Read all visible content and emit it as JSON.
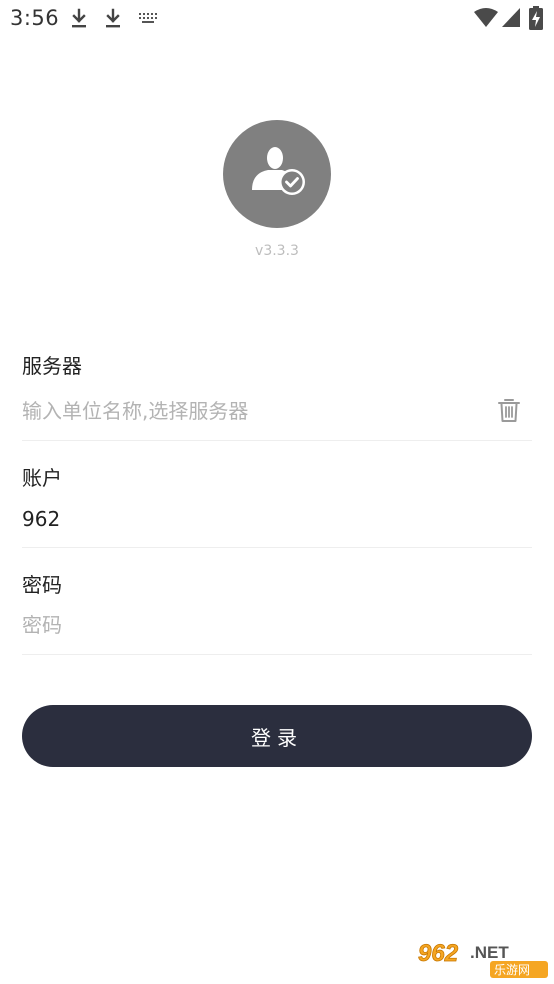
{
  "status_bar": {
    "time": "3:56",
    "icons": [
      "download-icon",
      "download-icon",
      "keyboard-icon",
      "wifi-icon",
      "signal-icon",
      "battery-charging-icon"
    ]
  },
  "header": {
    "avatar_icon": "user-check-icon",
    "version": "v3.3.3"
  },
  "form": {
    "server": {
      "label": "服务器",
      "value": "",
      "placeholder": "输入单位名称,选择服务器",
      "clear_icon": "trash-icon"
    },
    "account": {
      "label": "账户",
      "value": "962",
      "placeholder": ""
    },
    "password": {
      "label": "密码",
      "value": "",
      "placeholder": "密码"
    },
    "login_label": "登录"
  },
  "watermark": {
    "brand": "962.NET",
    "subtitle": "乐游网"
  },
  "colors": {
    "button_bg": "#2b2e3e",
    "avatar_bg": "#808080",
    "placeholder": "#b3b3b3",
    "divider": "#eeeeee"
  }
}
